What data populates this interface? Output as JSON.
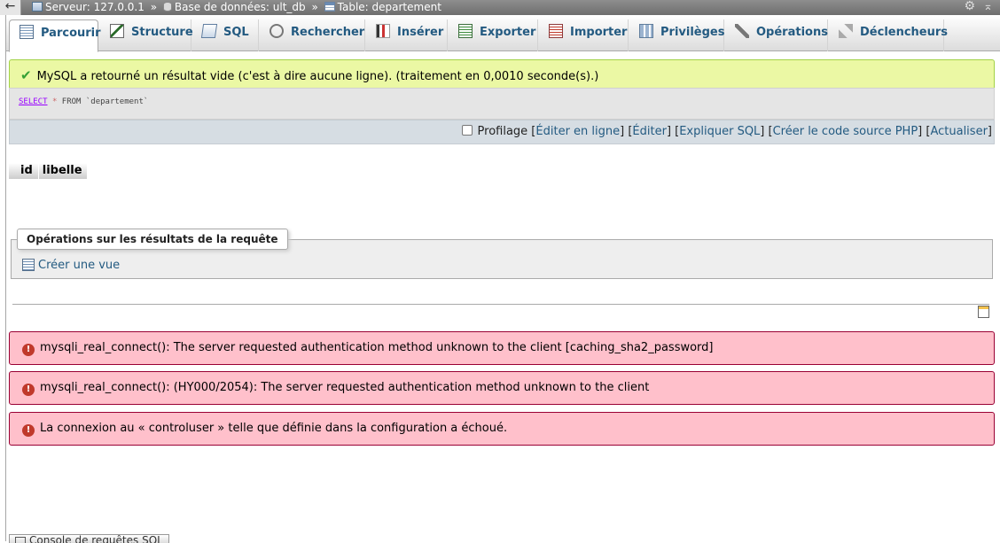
{
  "breadcrumb": {
    "server_icon": "server-icon",
    "server": "Serveur: 127.0.0.1",
    "database_icon": "database-icon",
    "database": "Base de données: ult_db",
    "table_icon": "table-icon",
    "table": "Table: departement",
    "separator": "»"
  },
  "tabs": [
    {
      "label": "Parcourir",
      "icon": "browse-icon"
    },
    {
      "label": "Structure",
      "icon": "structure-icon"
    },
    {
      "label": "SQL",
      "icon": "sql-icon"
    },
    {
      "label": "Rechercher",
      "icon": "search-icon"
    },
    {
      "label": "Insérer",
      "icon": "insert-icon"
    },
    {
      "label": "Exporter",
      "icon": "export-icon"
    },
    {
      "label": "Importer",
      "icon": "import-icon"
    },
    {
      "label": "Privilèges",
      "icon": "privileges-icon"
    },
    {
      "label": "Opérations",
      "icon": "operations-icon"
    },
    {
      "label": "Déclencheurs",
      "icon": "triggers-icon"
    }
  ],
  "success": {
    "icon": "check-icon",
    "message": "MySQL a retourné un résultat vide (c'est à dire aucune ligne). (traitement en 0,0010 seconde(s).)"
  },
  "query": {
    "keyword": "SELECT",
    "star": "*",
    "rest": "FROM `departement`"
  },
  "tools": {
    "profiling": "Profilage",
    "edit_inline": "Éditer en ligne",
    "edit": "Éditer",
    "explain": "Expliquer SQL",
    "php_code": "Créer le code source PHP",
    "refresh": "Actualiser"
  },
  "result_columns": [
    "id",
    "libelle"
  ],
  "query_ops": {
    "legend": "Opérations sur les résultats de la requête",
    "create_view": "Créer une vue"
  },
  "errors": [
    "mysqli_real_connect(): The server requested authentication method unknown to the client [caching_sha2_password]",
    "mysqli_real_connect(): (HY000/2054): The server requested authentication method unknown to the client",
    "La connexion au « controluser » telle que définie dans la configuration a échoué."
  ],
  "console": {
    "label": "Console de requêtes SQL"
  },
  "colors": {
    "success_bg": "#ebf8a4",
    "error_bg": "#ffc0cb",
    "link": "#235a81"
  }
}
